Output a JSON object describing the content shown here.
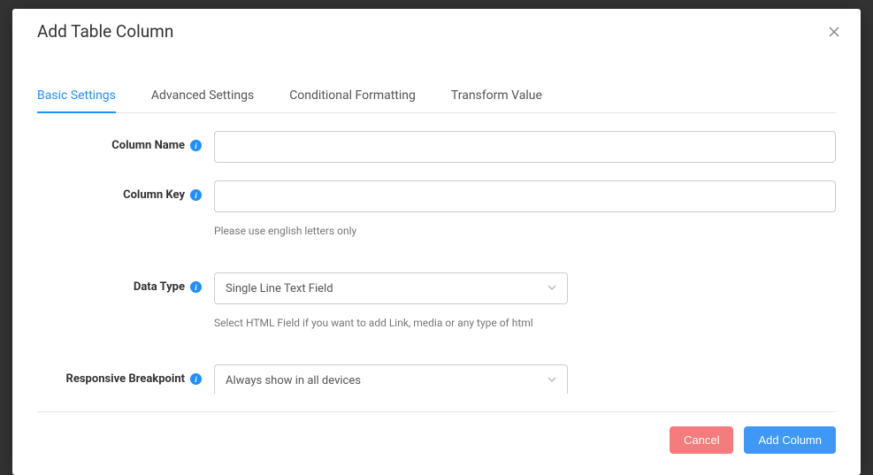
{
  "modal": {
    "title": "Add Table Column"
  },
  "tabs": [
    {
      "label": "Basic Settings",
      "active": true
    },
    {
      "label": "Advanced Settings",
      "active": false
    },
    {
      "label": "Conditional Formatting",
      "active": false
    },
    {
      "label": "Transform Value",
      "active": false
    }
  ],
  "form": {
    "column_name": {
      "label": "Column Name",
      "value": ""
    },
    "column_key": {
      "label": "Column Key",
      "value": "",
      "help": "Please use english letters only"
    },
    "data_type": {
      "label": "Data Type",
      "value": "Single Line Text Field",
      "help": "Select HTML Field if you want to add Link, media or any type of html"
    },
    "responsive_breakpoint": {
      "label": "Responsive Breakpoint",
      "value": "Always show in all devices"
    }
  },
  "footer": {
    "cancel": "Cancel",
    "submit": "Add Column"
  }
}
